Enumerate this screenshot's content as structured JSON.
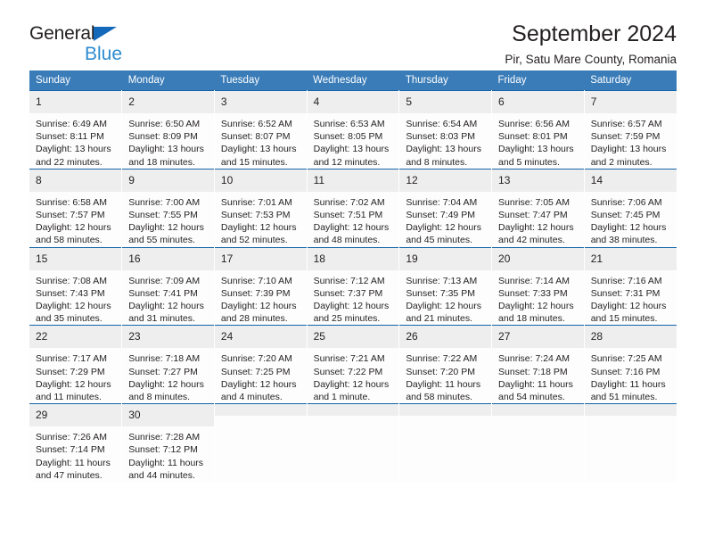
{
  "brand": {
    "line1": "General",
    "line2": "Blue",
    "triangle_color": "#1569ba",
    "line2_color": "#2e8bd0"
  },
  "header": {
    "title": "September 2024",
    "subtitle": "Pir, Satu Mare County, Romania"
  },
  "theme": {
    "header_bg": "#3a7cb8",
    "row_divider": "#1565a8",
    "daynum_bg": "#eeeeee",
    "cell_bg": "#fdfdfd",
    "text": "#231f20"
  },
  "weekday_headers": [
    "Sunday",
    "Monday",
    "Tuesday",
    "Wednesday",
    "Thursday",
    "Friday",
    "Saturday"
  ],
  "weeks": [
    [
      {
        "day": "1",
        "sunrise": "Sunrise: 6:49 AM",
        "sunset": "Sunset: 8:11 PM",
        "daylight1": "Daylight: 13 hours",
        "daylight2": "and 22 minutes."
      },
      {
        "day": "2",
        "sunrise": "Sunrise: 6:50 AM",
        "sunset": "Sunset: 8:09 PM",
        "daylight1": "Daylight: 13 hours",
        "daylight2": "and 18 minutes."
      },
      {
        "day": "3",
        "sunrise": "Sunrise: 6:52 AM",
        "sunset": "Sunset: 8:07 PM",
        "daylight1": "Daylight: 13 hours",
        "daylight2": "and 15 minutes."
      },
      {
        "day": "4",
        "sunrise": "Sunrise: 6:53 AM",
        "sunset": "Sunset: 8:05 PM",
        "daylight1": "Daylight: 13 hours",
        "daylight2": "and 12 minutes."
      },
      {
        "day": "5",
        "sunrise": "Sunrise: 6:54 AM",
        "sunset": "Sunset: 8:03 PM",
        "daylight1": "Daylight: 13 hours",
        "daylight2": "and 8 minutes."
      },
      {
        "day": "6",
        "sunrise": "Sunrise: 6:56 AM",
        "sunset": "Sunset: 8:01 PM",
        "daylight1": "Daylight: 13 hours",
        "daylight2": "and 5 minutes."
      },
      {
        "day": "7",
        "sunrise": "Sunrise: 6:57 AM",
        "sunset": "Sunset: 7:59 PM",
        "daylight1": "Daylight: 13 hours",
        "daylight2": "and 2 minutes."
      }
    ],
    [
      {
        "day": "8",
        "sunrise": "Sunrise: 6:58 AM",
        "sunset": "Sunset: 7:57 PM",
        "daylight1": "Daylight: 12 hours",
        "daylight2": "and 58 minutes."
      },
      {
        "day": "9",
        "sunrise": "Sunrise: 7:00 AM",
        "sunset": "Sunset: 7:55 PM",
        "daylight1": "Daylight: 12 hours",
        "daylight2": "and 55 minutes."
      },
      {
        "day": "10",
        "sunrise": "Sunrise: 7:01 AM",
        "sunset": "Sunset: 7:53 PM",
        "daylight1": "Daylight: 12 hours",
        "daylight2": "and 52 minutes."
      },
      {
        "day": "11",
        "sunrise": "Sunrise: 7:02 AM",
        "sunset": "Sunset: 7:51 PM",
        "daylight1": "Daylight: 12 hours",
        "daylight2": "and 48 minutes."
      },
      {
        "day": "12",
        "sunrise": "Sunrise: 7:04 AM",
        "sunset": "Sunset: 7:49 PM",
        "daylight1": "Daylight: 12 hours",
        "daylight2": "and 45 minutes."
      },
      {
        "day": "13",
        "sunrise": "Sunrise: 7:05 AM",
        "sunset": "Sunset: 7:47 PM",
        "daylight1": "Daylight: 12 hours",
        "daylight2": "and 42 minutes."
      },
      {
        "day": "14",
        "sunrise": "Sunrise: 7:06 AM",
        "sunset": "Sunset: 7:45 PM",
        "daylight1": "Daylight: 12 hours",
        "daylight2": "and 38 minutes."
      }
    ],
    [
      {
        "day": "15",
        "sunrise": "Sunrise: 7:08 AM",
        "sunset": "Sunset: 7:43 PM",
        "daylight1": "Daylight: 12 hours",
        "daylight2": "and 35 minutes."
      },
      {
        "day": "16",
        "sunrise": "Sunrise: 7:09 AM",
        "sunset": "Sunset: 7:41 PM",
        "daylight1": "Daylight: 12 hours",
        "daylight2": "and 31 minutes."
      },
      {
        "day": "17",
        "sunrise": "Sunrise: 7:10 AM",
        "sunset": "Sunset: 7:39 PM",
        "daylight1": "Daylight: 12 hours",
        "daylight2": "and 28 minutes."
      },
      {
        "day": "18",
        "sunrise": "Sunrise: 7:12 AM",
        "sunset": "Sunset: 7:37 PM",
        "daylight1": "Daylight: 12 hours",
        "daylight2": "and 25 minutes."
      },
      {
        "day": "19",
        "sunrise": "Sunrise: 7:13 AM",
        "sunset": "Sunset: 7:35 PM",
        "daylight1": "Daylight: 12 hours",
        "daylight2": "and 21 minutes."
      },
      {
        "day": "20",
        "sunrise": "Sunrise: 7:14 AM",
        "sunset": "Sunset: 7:33 PM",
        "daylight1": "Daylight: 12 hours",
        "daylight2": "and 18 minutes."
      },
      {
        "day": "21",
        "sunrise": "Sunrise: 7:16 AM",
        "sunset": "Sunset: 7:31 PM",
        "daylight1": "Daylight: 12 hours",
        "daylight2": "and 15 minutes."
      }
    ],
    [
      {
        "day": "22",
        "sunrise": "Sunrise: 7:17 AM",
        "sunset": "Sunset: 7:29 PM",
        "daylight1": "Daylight: 12 hours",
        "daylight2": "and 11 minutes."
      },
      {
        "day": "23",
        "sunrise": "Sunrise: 7:18 AM",
        "sunset": "Sunset: 7:27 PM",
        "daylight1": "Daylight: 12 hours",
        "daylight2": "and 8 minutes."
      },
      {
        "day": "24",
        "sunrise": "Sunrise: 7:20 AM",
        "sunset": "Sunset: 7:25 PM",
        "daylight1": "Daylight: 12 hours",
        "daylight2": "and 4 minutes."
      },
      {
        "day": "25",
        "sunrise": "Sunrise: 7:21 AM",
        "sunset": "Sunset: 7:22 PM",
        "daylight1": "Daylight: 12 hours",
        "daylight2": "and 1 minute."
      },
      {
        "day": "26",
        "sunrise": "Sunrise: 7:22 AM",
        "sunset": "Sunset: 7:20 PM",
        "daylight1": "Daylight: 11 hours",
        "daylight2": "and 58 minutes."
      },
      {
        "day": "27",
        "sunrise": "Sunrise: 7:24 AM",
        "sunset": "Sunset: 7:18 PM",
        "daylight1": "Daylight: 11 hours",
        "daylight2": "and 54 minutes."
      },
      {
        "day": "28",
        "sunrise": "Sunrise: 7:25 AM",
        "sunset": "Sunset: 7:16 PM",
        "daylight1": "Daylight: 11 hours",
        "daylight2": "and 51 minutes."
      }
    ],
    [
      {
        "day": "29",
        "sunrise": "Sunrise: 7:26 AM",
        "sunset": "Sunset: 7:14 PM",
        "daylight1": "Daylight: 11 hours",
        "daylight2": "and 47 minutes."
      },
      {
        "day": "30",
        "sunrise": "Sunrise: 7:28 AM",
        "sunset": "Sunset: 7:12 PM",
        "daylight1": "Daylight: 11 hours",
        "daylight2": "and 44 minutes."
      },
      {
        "day": "",
        "sunrise": "",
        "sunset": "",
        "daylight1": "",
        "daylight2": ""
      },
      {
        "day": "",
        "sunrise": "",
        "sunset": "",
        "daylight1": "",
        "daylight2": ""
      },
      {
        "day": "",
        "sunrise": "",
        "sunset": "",
        "daylight1": "",
        "daylight2": ""
      },
      {
        "day": "",
        "sunrise": "",
        "sunset": "",
        "daylight1": "",
        "daylight2": ""
      },
      {
        "day": "",
        "sunrise": "",
        "sunset": "",
        "daylight1": "",
        "daylight2": ""
      }
    ]
  ]
}
